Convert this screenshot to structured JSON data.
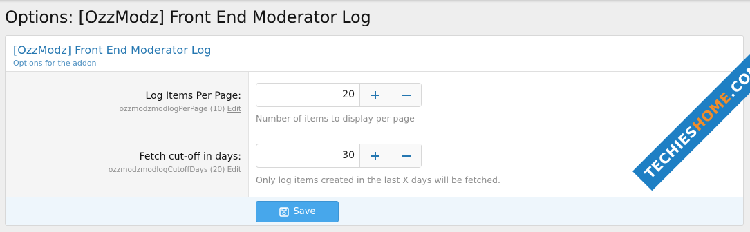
{
  "page": {
    "title": "Options: [OzzModz] Front End Moderator Log"
  },
  "block": {
    "title": "[OzzModz] Front End Moderator Log",
    "description": "Options for the addon"
  },
  "options": [
    {
      "label": "Log Items Per Page:",
      "hint_text": "ozzmodzmodlogPerPage (10)",
      "edit_label": "Edit",
      "value": "20",
      "explain": "Number of items to display per page"
    },
    {
      "label": "Fetch cut-off in days:",
      "hint_text": "ozzmodzmodlogCutoffDays (20)",
      "edit_label": "Edit",
      "value": "30",
      "explain": "Only log items created in the last X days will be fetched."
    }
  ],
  "footer": {
    "save_label": "Save",
    "save_icon": "save-icon"
  },
  "watermark": {
    "part1": "TECHIES",
    "part2": "HOME",
    "part3": ".COM"
  },
  "colors": {
    "accent": "#47a7eb",
    "title_blue": "#2577b1",
    "watermark_blue": "#1e7fc4",
    "watermark_orange": "#f28c28"
  }
}
